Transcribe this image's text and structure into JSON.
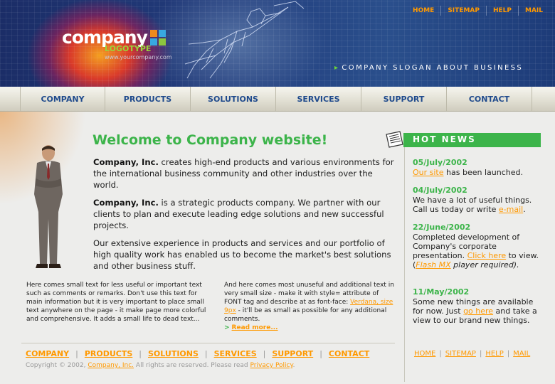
{
  "header": {
    "top_nav": [
      "HOME",
      "SITEMAP",
      "HELP",
      "MAIL"
    ],
    "logo": {
      "name": "company",
      "type": "LOGOTYPE",
      "url": "www.yourcompany.com"
    },
    "slogan": "COMPANY SLOGAN ABOUT BUSINESS"
  },
  "main_nav": [
    "COMPANY",
    "PRODUCTS",
    "SOLUTIONS",
    "SERVICES",
    "SUPPORT",
    "CONTACT"
  ],
  "content": {
    "title": "Welcome to Company website!",
    "p1_bold": "Company, Inc.",
    "p1": " creates high-end products and various environments for the international business community and other industries over the world.",
    "p2_bold": "Company, Inc.",
    "p2": " is a strategic products company. We partner with our clients to plan and execute leading edge solutions and new successful projects.",
    "p3": "Our extensive experience in products and services and our portfolio of high quality work has enabled us to become the market's best solutions and other business stuff.",
    "small1": "Here comes small text for less useful or important text such as comments or remarks. Don't use this text for main information but it is very important to place small text anywhere on the page - it make page more colorful and comprehensive. It adds a small life to dead text...",
    "small2_a": "And here comes most unuseful and additional text in very small size - make it with style= attribute of FONT tag and describe at as font-face: ",
    "small2_link": "Verdana, size 9px",
    "small2_b": " - it'll be as small as possible for any additional comments.",
    "read_more": "Read more..."
  },
  "hot_news": {
    "title": "HOT NEWS",
    "items": [
      {
        "date": "05/July/2002",
        "link": "Our site",
        "text": " has been launched."
      },
      {
        "date": "04/July/2002",
        "text": "We have a lot of useful things. Call us today or write ",
        "link": "e-mail",
        "text_after": "."
      },
      {
        "date": "22/June/2002",
        "text": "Completed development of Company's corporate presentation. ",
        "link": "Click here",
        "text_mid": " to view. (",
        "link2": "Flash MX",
        "text_after": " player required)."
      },
      {
        "date": "11/May/2002",
        "text": "Some new things are available for now. Just ",
        "link": "go here",
        "text_after": " and take a view to our brand new things."
      }
    ]
  },
  "footer": {
    "nav": [
      "COMPANY",
      "PRODUCTS",
      "SOLUTIONS",
      "SERVICES",
      "SUPPORT",
      "CONTACT"
    ],
    "copyright_prefix": "Copyright © 2002, ",
    "copyright_company": "Company, Inc.",
    "copyright_mid": " All rights are reserved. Please read ",
    "privacy": "Privacy Policy",
    "copyright_suffix": ".",
    "nav2": [
      "HOME",
      "SITEMAP",
      "HELP",
      "MAIL"
    ]
  },
  "colors": {
    "accent_green": "#3cb44a",
    "link_orange": "#ff9900",
    "nav_blue": "#1f4a8c"
  },
  "icons": [
    "news-paper-icon",
    "arrow-right-icon"
  ]
}
